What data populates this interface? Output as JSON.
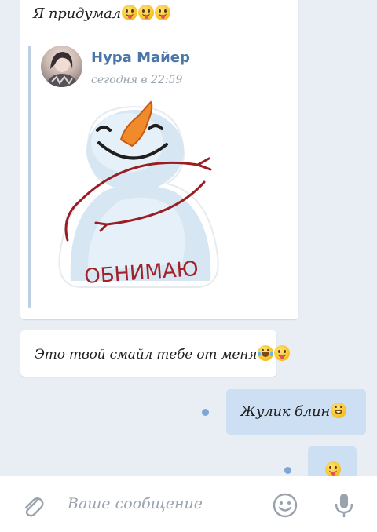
{
  "messages": {
    "first": {
      "text": "Я придумал",
      "emoji_count": 3,
      "emoji": "tongue-face"
    },
    "forwarded": {
      "author": "Нура Майер",
      "time": "сегодня в 22:59",
      "sticker_text": "ОБНИМАЮ",
      "sticker": "snowman-hug"
    },
    "second": {
      "text": "Это твой смайл тебе от меня",
      "emojis": [
        "laughing-tears-face",
        "tongue-face"
      ]
    },
    "outgoing_1": {
      "text": "Жулик блин",
      "emoji": "grinning-face"
    },
    "outgoing_2": {
      "emoji": "tongue-face"
    }
  },
  "composer": {
    "placeholder": "Ваше сообщение",
    "icons": [
      "paperclip-icon",
      "emoji-icon",
      "mic-icon"
    ]
  },
  "colors": {
    "background": "#e9eef4",
    "incoming_bubble": "#ffffff",
    "outgoing_bubble": "#cddff3",
    "author": "#4a76a8",
    "sticker_text": "#a3222a"
  }
}
